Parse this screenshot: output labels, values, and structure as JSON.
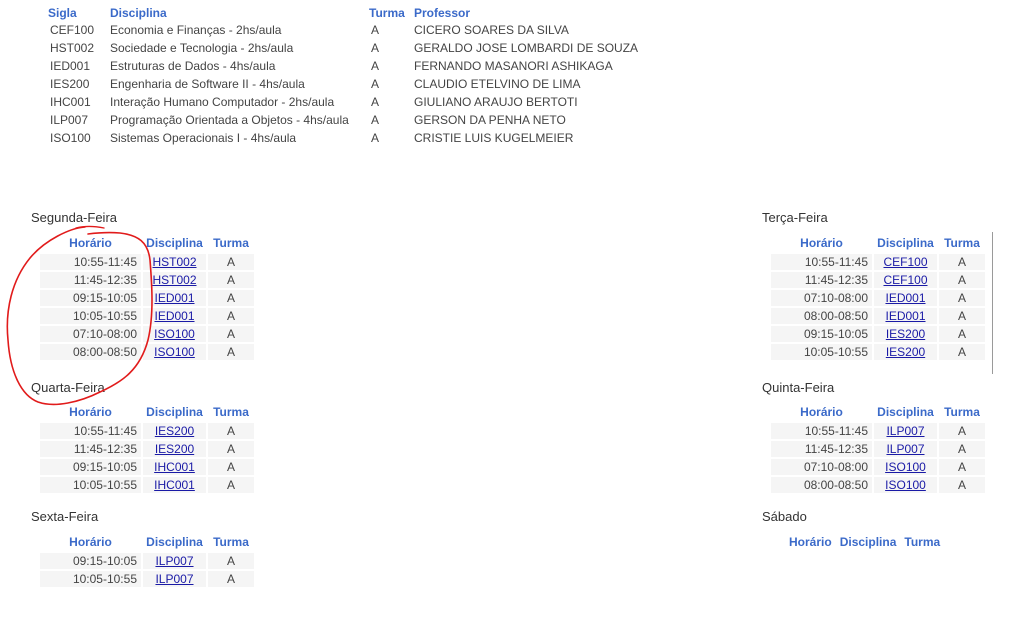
{
  "disciplines": {
    "headers": {
      "sigla": "Sigla",
      "disciplina": "Disciplina",
      "turma": "Turma",
      "professor": "Professor"
    },
    "rows": [
      {
        "sigla": "CEF100",
        "disciplina": "Economia e Finanças - 2hs/aula",
        "turma": "A",
        "professor": "CICERO SOARES DA SILVA"
      },
      {
        "sigla": "HST002",
        "disciplina": "Sociedade e Tecnologia - 2hs/aula",
        "turma": "A",
        "professor": "GERALDO JOSE LOMBARDI DE SOUZA"
      },
      {
        "sigla": "IED001",
        "disciplina": "Estruturas de Dados - 4hs/aula",
        "turma": "A",
        "professor": "FERNANDO MASANORI ASHIKAGA"
      },
      {
        "sigla": "IES200",
        "disciplina": "Engenharia de Software II - 4hs/aula",
        "turma": "A",
        "professor": "CLAUDIO ETELVINO DE LIMA"
      },
      {
        "sigla": "IHC001",
        "disciplina": "Interação Humano Computador - 2hs/aula",
        "turma": "A",
        "professor": "GIULIANO ARAUJO BERTOTI"
      },
      {
        "sigla": "ILP007",
        "disciplina": "Programação Orientada a Objetos - 4hs/aula",
        "turma": "A",
        "professor": "GERSON DA PENHA NETO"
      },
      {
        "sigla": "ISO100",
        "disciplina": "Sistemas Operacionais I - 4hs/aula",
        "turma": "A",
        "professor": "CRISTIE LUIS KUGELMEIER"
      }
    ]
  },
  "schedule_headers": {
    "horario": "Horário",
    "disciplina": "Disciplina",
    "turma": "Turma"
  },
  "days": {
    "segunda": {
      "title": "Segunda-Feira",
      "rows": [
        {
          "horario": "10:55-11:45",
          "disciplina": "HST002",
          "turma": "A"
        },
        {
          "horario": "11:45-12:35",
          "disciplina": "HST002",
          "turma": "A"
        },
        {
          "horario": "09:15-10:05",
          "disciplina": "IED001",
          "turma": "A"
        },
        {
          "horario": "10:05-10:55",
          "disciplina": "IED001",
          "turma": "A"
        },
        {
          "horario": "07:10-08:00",
          "disciplina": "ISO100",
          "turma": "A"
        },
        {
          "horario": "08:00-08:50",
          "disciplina": "ISO100",
          "turma": "A"
        }
      ]
    },
    "terca": {
      "title": "Terça-Feira",
      "rows": [
        {
          "horario": "10:55-11:45",
          "disciplina": "CEF100",
          "turma": "A"
        },
        {
          "horario": "11:45-12:35",
          "disciplina": "CEF100",
          "turma": "A"
        },
        {
          "horario": "07:10-08:00",
          "disciplina": "IED001",
          "turma": "A"
        },
        {
          "horario": "08:00-08:50",
          "disciplina": "IED001",
          "turma": "A"
        },
        {
          "horario": "09:15-10:05",
          "disciplina": "IES200",
          "turma": "A"
        },
        {
          "horario": "10:05-10:55",
          "disciplina": "IES200",
          "turma": "A"
        }
      ]
    },
    "quarta": {
      "title": "Quarta-Feira",
      "rows": [
        {
          "horario": "10:55-11:45",
          "disciplina": "IES200",
          "turma": "A"
        },
        {
          "horario": "11:45-12:35",
          "disciplina": "IES200",
          "turma": "A"
        },
        {
          "horario": "09:15-10:05",
          "disciplina": "IHC001",
          "turma": "A"
        },
        {
          "horario": "10:05-10:55",
          "disciplina": "IHC001",
          "turma": "A"
        }
      ]
    },
    "quinta": {
      "title": "Quinta-Feira",
      "rows": [
        {
          "horario": "10:55-11:45",
          "disciplina": "ILP007",
          "turma": "A"
        },
        {
          "horario": "11:45-12:35",
          "disciplina": "ILP007",
          "turma": "A"
        },
        {
          "horario": "07:10-08:00",
          "disciplina": "ISO100",
          "turma": "A"
        },
        {
          "horario": "08:00-08:50",
          "disciplina": "ISO100",
          "turma": "A"
        }
      ]
    },
    "sexta": {
      "title": "Sexta-Feira",
      "rows": [
        {
          "horario": "09:15-10:05",
          "disciplina": "ILP007",
          "turma": "A"
        },
        {
          "horario": "10:05-10:55",
          "disciplina": "ILP007",
          "turma": "A"
        }
      ]
    },
    "sabado": {
      "title": "Sábado",
      "rows": []
    }
  },
  "colors": {
    "header": "#3b6ac9",
    "link": "#1a1aa6",
    "stripe": "#f5f5f5",
    "annotation": "#e11b1b"
  }
}
